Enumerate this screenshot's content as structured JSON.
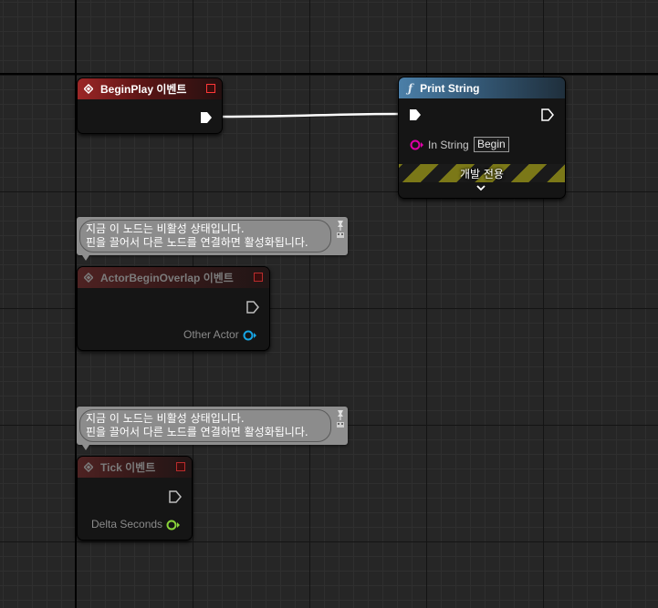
{
  "nodes": {
    "begin_play": {
      "title": "BeginPlay 이벤트"
    },
    "print_string": {
      "title": "Print String",
      "in_string_label": "In String",
      "in_string_value": "Begin",
      "dev_only_label": "개발 전용"
    },
    "actor_begin_overlap": {
      "title": "ActorBeginOverlap 이벤트",
      "output_label": "Other Actor"
    },
    "tick": {
      "title": "Tick 이벤트",
      "output_label": "Delta Seconds"
    }
  },
  "comments": {
    "overlap_comment": {
      "line1": "지금 이 노드는 비활성 상태입니다.",
      "line2": "핀을 끌어서 다른 노드를 연결하면 활성화됩니다."
    },
    "tick_comment": {
      "line1": "지금 이 노드는 비활성 상태입니다.",
      "line2": "핀을 끌어서 다른 노드를 연결하면 활성화됩니다."
    }
  },
  "colors": {
    "event_header": "#9c2626",
    "function_header": "#4b7fa8",
    "string_pin": "#e000a8",
    "object_pin": "#16a6e6",
    "float_pin": "#8ad33a",
    "exec_pin": "#ffffff",
    "dev_only_stripe": "#7b7818"
  }
}
